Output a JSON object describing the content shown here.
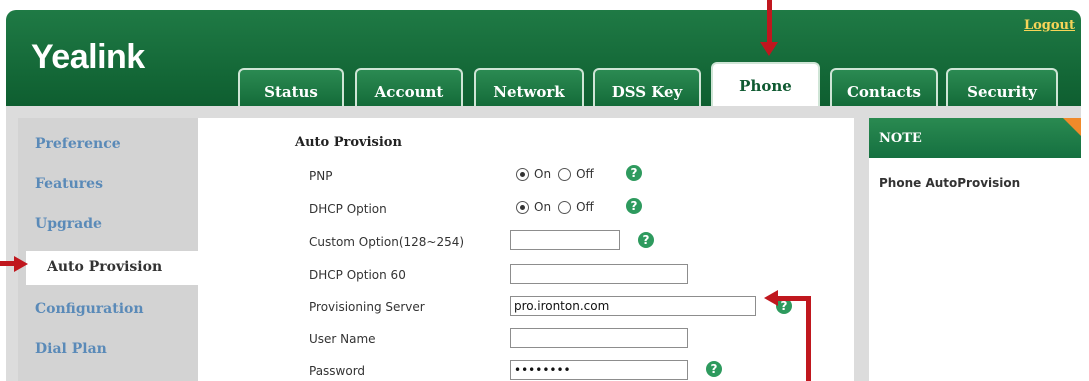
{
  "app": {
    "logo": "Yealink",
    "logout_label": "Logout"
  },
  "tabs": [
    {
      "label": "Status"
    },
    {
      "label": "Account"
    },
    {
      "label": "Network"
    },
    {
      "label": "DSS Key"
    },
    {
      "label": "Phone",
      "active": true
    },
    {
      "label": "Contacts"
    },
    {
      "label": "Security"
    }
  ],
  "sidebar": {
    "items": [
      {
        "label": "Preference"
      },
      {
        "label": "Features"
      },
      {
        "label": "Upgrade"
      },
      {
        "label": "Auto Provision",
        "active": true
      },
      {
        "label": "Configuration"
      },
      {
        "label": "Dial Plan"
      }
    ]
  },
  "form": {
    "section_title": "Auto Provision",
    "pnp": {
      "label": "PNP",
      "on_label": "On",
      "off_label": "Off",
      "selected": "On"
    },
    "dhcp_option": {
      "label": "DHCP Option",
      "on_label": "On",
      "off_label": "Off",
      "selected": "On"
    },
    "custom_option": {
      "label": "Custom Option(128~254)",
      "value": ""
    },
    "dhcp_option_60": {
      "label": "DHCP Option 60",
      "value": ""
    },
    "provisioning_server": {
      "label": "Provisioning Server",
      "value": "pro.ironton.com"
    },
    "user_name": {
      "label": "User Name",
      "value": ""
    },
    "password": {
      "label": "Password",
      "value": "••••••••"
    },
    "help_symbol": "?"
  },
  "note": {
    "title": "NOTE",
    "text": "Phone AutoProvision"
  },
  "colors": {
    "header_green": "#1a7441",
    "annotation_red": "#c0171e",
    "sidebar_link": "#5a8ab8",
    "note_corner": "#f08a2a"
  }
}
